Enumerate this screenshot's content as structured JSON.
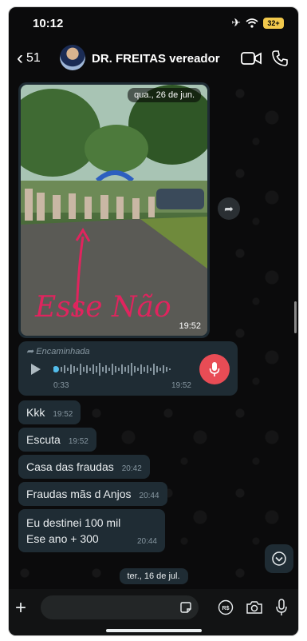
{
  "status_bar": {
    "time": "10:12",
    "battery": "32+"
  },
  "header": {
    "back_count": "51",
    "contact_name": "DR. FREITAS vereador"
  },
  "messages": {
    "image": {
      "date_label": "qua., 26 de jun.",
      "time": "19:52",
      "overlay_text": "Esse Não"
    },
    "audio": {
      "forwarded_label": "Encaminhada",
      "current": "0:33",
      "time": "19:52"
    },
    "texts": [
      {
        "text": "Kkk",
        "time": "19:52"
      },
      {
        "text": "Escuta",
        "time": "19:52"
      },
      {
        "text": "Casa das fraudas",
        "time": "20:42"
      },
      {
        "text": "Fraudas mãs d Anjos",
        "time": "20:44"
      },
      {
        "line1": "Eu destinei 100 mil",
        "line2": "Ese ano + 300",
        "time": "20:44"
      }
    ],
    "next_date": "ter., 16 de jul."
  },
  "input": {
    "placeholder": ""
  },
  "icons": {
    "back": "chevron-left-icon",
    "video": "video-icon",
    "call": "phone-icon",
    "share": "share-icon",
    "play": "play-icon",
    "mic": "microphone-icon",
    "plus": "plus-icon",
    "sticker": "sticker-icon",
    "payment": "rs-payment-icon",
    "camera": "camera-icon"
  },
  "colors": {
    "bubble": "#1f2c34",
    "background": "#0b0b0c",
    "mic_accent": "#e84c55",
    "text": "#e9edef",
    "meta": "#8696a0"
  }
}
